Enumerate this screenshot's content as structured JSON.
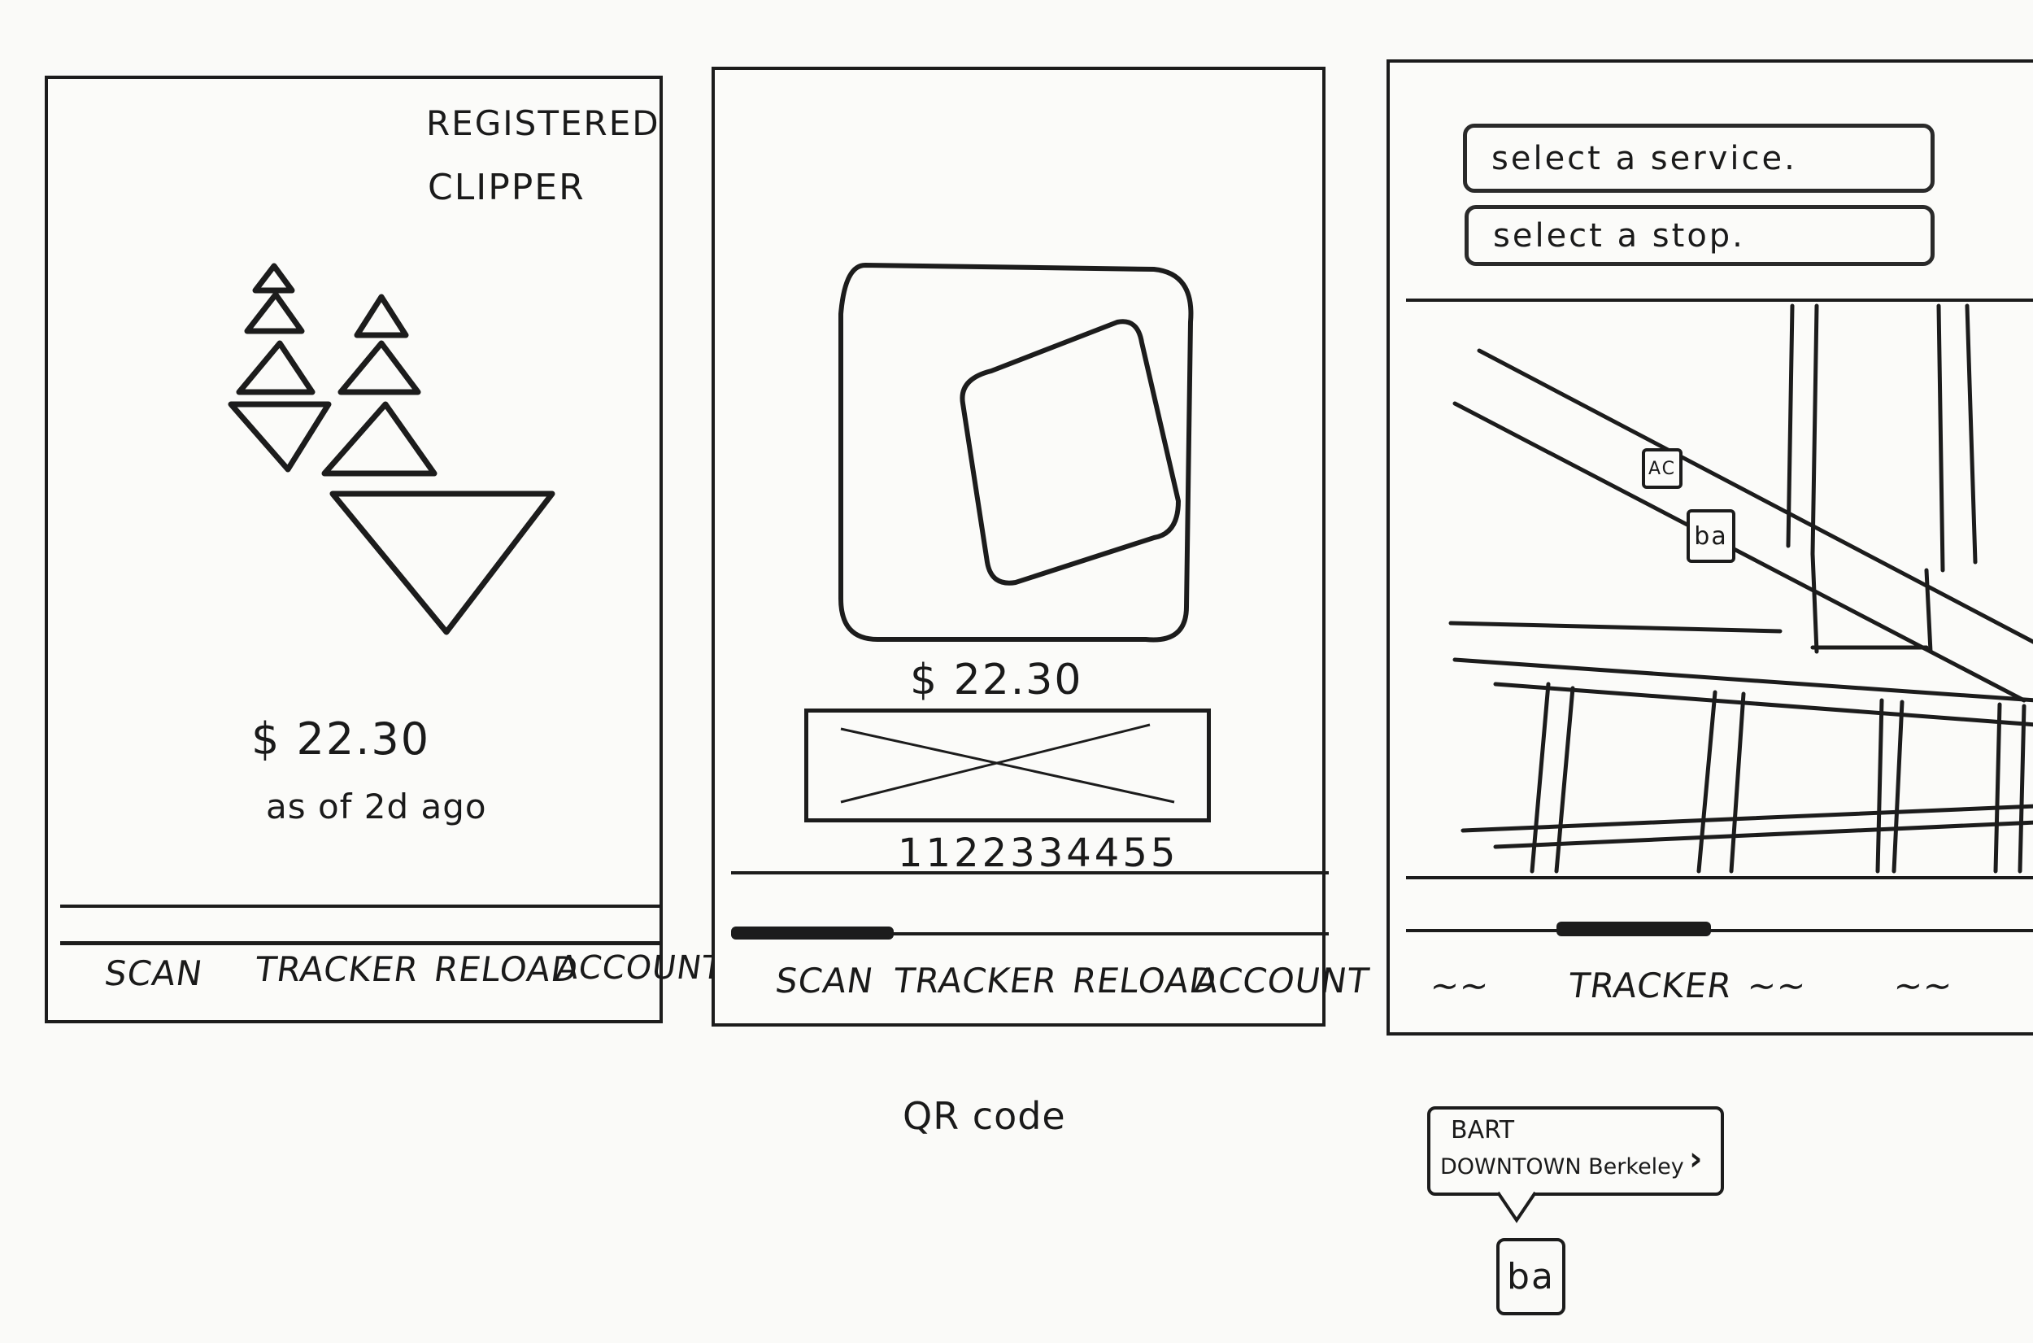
{
  "screens": {
    "card": {
      "title_line1": "REGISTERED",
      "title_line2": "CLIPPER",
      "balance": "$ 22.30",
      "balance_note": "as of 2d ago",
      "nav": [
        "SCAN",
        "TRACKER",
        "RELOAD",
        "ACCOUNT"
      ]
    },
    "scan": {
      "balance": "$ 22.30",
      "card_number": "1122334455",
      "nav": [
        "SCAN",
        "TRACKER",
        "RELOAD",
        "ACCOUNT"
      ],
      "caption": "QR code"
    },
    "tracker": {
      "service_placeholder": "select a service.",
      "stop_placeholder": "select a stop.",
      "map_stops": [
        "AC",
        "ba"
      ],
      "nav_center": "TRACKER",
      "nav_placeholders": [
        "~~",
        "~~",
        "~~"
      ],
      "popup": {
        "agency": "BART",
        "stop": "DOWNTOWN Berkeley",
        "pin": "ba"
      }
    }
  },
  "colors": {
    "ink": "#1c1c1c",
    "paper": "#fafaf8"
  }
}
